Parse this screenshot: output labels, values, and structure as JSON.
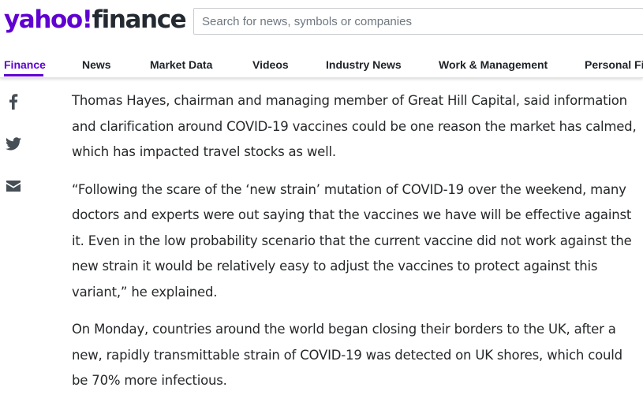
{
  "header": {
    "logo_yahoo": "yahoo!",
    "logo_finance": "finance",
    "search_placeholder": "Search for news, symbols or companies"
  },
  "nav": {
    "items": [
      {
        "label": "Finance",
        "active": true
      },
      {
        "label": "News"
      },
      {
        "label": "Market Data"
      },
      {
        "label": "Videos"
      },
      {
        "label": "Industry News"
      },
      {
        "label": "Work & Management"
      },
      {
        "label": "Personal Fin"
      }
    ]
  },
  "share": {
    "icons": [
      "facebook-icon",
      "twitter-icon",
      "mail-icon"
    ]
  },
  "article": {
    "paragraphs": [
      "Thomas Hayes, chairman and managing member of Great Hill Capital, said information and clarification around COVID-19 vaccines could be one reason the market has calmed, which has impacted travel stocks as well.",
      "“Following the scare of the ‘new strain’ mutation of COVID-19 over the weekend, many doctors and experts were out saying that the vaccines we have will be effective against it. Even in the low probability scenario that the current vaccine did not work against the new strain it would be relatively easy to adjust the vaccines to protect against this variant,” he explained.",
      "On Monday, countries around the world began closing their borders to the UK, after a new, rapidly transmittable strain of COVID-19 was detected on UK shores, which could be 70% more infectious."
    ]
  },
  "colors": {
    "brand_purple": "#6001d2",
    "text": "#26282a",
    "icon": "#464e56"
  }
}
